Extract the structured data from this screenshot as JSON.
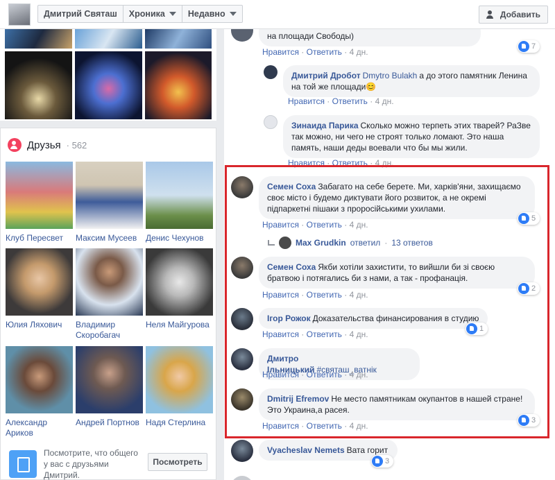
{
  "topbar": {
    "profile_name": "Дмитрий Святаш",
    "tab_timeline": "Хроника",
    "filter_recent": "Недавно",
    "add_friend": "Добавить"
  },
  "friends": {
    "title": "Друзья",
    "count": "· 562",
    "items": [
      {
        "name": "Клуб Пересвет"
      },
      {
        "name": "Максим Мусеев"
      },
      {
        "name": "Денис Чехунов"
      },
      {
        "name": "Юлия Ляхович"
      },
      {
        "name": "Владимир Скоробагач"
      },
      {
        "name": "Неля Майгурова"
      },
      {
        "name": "Александр Ариков"
      },
      {
        "name": "Андрей Портнов"
      },
      {
        "name": "Надя Стерлина"
      }
    ],
    "suggest_text": "Посмотрите, что общего у вас с друзьями Дмитрий.",
    "see_button": "Посмотреть"
  },
  "actions": {
    "like": "Нравится",
    "reply": "Ответить",
    "sep": "·"
  },
  "comments": [
    {
      "author": "",
      "text": "на площади Свободы)",
      "time": "4 дн.",
      "reactions": "7"
    },
    {
      "author": "Дмитрий Дробот",
      "tag": "Dmytro Bulakh",
      "text": "а до этого памятник Ленина на той же площади😊",
      "time": "4 дн.",
      "reactions": ""
    },
    {
      "author": "Зинаида Парика",
      "text": "Сколько можно терпеть этих тварей? РаЗве так можно, ни чего не строят только ломают. Это наша память, наши деды воевали что бы мы жили.",
      "time": "4 дн.",
      "reactions": ""
    },
    {
      "author": "Семен Соха",
      "text": "Забагато на себе берете. Ми, харків'яни, захищаємо своє місто і будемо диктувати його розвиток, а не окремі підпаркетні пішаки з проросійськими ухилами.",
      "time": "4 дн.",
      "reactions": "5"
    },
    {
      "author": "Семен Соха",
      "text": "Якби хотіли захистити, то вийшли би зі своєю братвою і потягались би з нами, а так - профанація.",
      "time": "4 дн.",
      "reactions": "2"
    },
    {
      "author": "Ігор Рожок",
      "text": "Доказательства финансирования в студию",
      "time": "4 дн.",
      "reactions": "1"
    },
    {
      "author": "Дмитро Ільницький",
      "text": "#святаш_ватнік",
      "time": "4 дн.",
      "reactions": ""
    },
    {
      "author": "Dmitrij Efremov",
      "text": "Не место памятникам окупантов в нашей стране! Это Украина,а расея.",
      "time": "4 дн.",
      "reactions": "3"
    },
    {
      "author": "Vyacheslav Nemets",
      "text": "Вата горит",
      "time": "",
      "reactions": "3"
    }
  ],
  "thread": {
    "name": "Max Grudkin",
    "verb": "ответил",
    "sep": "·",
    "count": "13 ответов"
  },
  "colors": {
    "link": "#385898",
    "action_link": "#4267b2",
    "highlight": "#d9262c",
    "like": "#2e7cf6"
  }
}
